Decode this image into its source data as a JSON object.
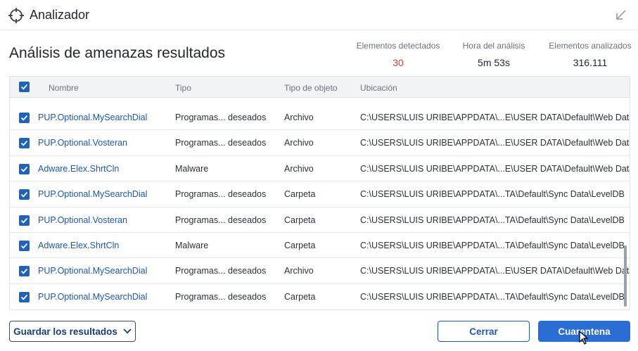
{
  "window": {
    "title": "Analizador"
  },
  "page": {
    "title": "Análisis de amenazas resultados"
  },
  "stats": {
    "detected_label": "Elementos detectados",
    "detected_value": "30",
    "time_label": "Hora del análisis",
    "time_value": "5m 53s",
    "scanned_label": "Elementos analizados",
    "scanned_value": "316.111"
  },
  "table": {
    "headers": {
      "name": "Nombre",
      "type": "Tipo",
      "object": "Tipo de objeto",
      "location": "Ubicación"
    },
    "rows": [
      {
        "name": "PUP.Optional.MySearchDial",
        "type": "Programas... deseados",
        "object": "Archivo",
        "location": "C:\\USERS\\LUIS URIBE\\APPDATA\\...E\\USER DATA\\Default\\Web Data",
        "checked": true
      },
      {
        "name": "PUP.Optional.Vosteran",
        "type": "Programas... deseados",
        "object": "Archivo",
        "location": "C:\\USERS\\LUIS URIBE\\APPDATA\\...E\\USER DATA\\Default\\Web Data",
        "checked": true
      },
      {
        "name": "Adware.Elex.ShrtCln",
        "type": "Malware",
        "object": "Archivo",
        "location": "C:\\USERS\\LUIS URIBE\\APPDATA\\...E\\USER DATA\\Default\\Web Data",
        "checked": true
      },
      {
        "name": "PUP.Optional.MySearchDial",
        "type": "Programas... deseados",
        "object": "Carpeta",
        "location": "C:\\USERS\\LUIS URIBE\\APPDATA\\...TA\\Default\\Sync Data\\LevelDB",
        "checked": true
      },
      {
        "name": "PUP.Optional.Vosteran",
        "type": "Programas... deseados",
        "object": "Carpeta",
        "location": "C:\\USERS\\LUIS URIBE\\APPDATA\\...TA\\Default\\Sync Data\\LevelDB",
        "checked": true
      },
      {
        "name": "Adware.Elex.ShrtCln",
        "type": "Malware",
        "object": "Carpeta",
        "location": "C:\\USERS\\LUIS URIBE\\APPDATA\\...TA\\Default\\Sync Data\\LevelDB",
        "checked": true
      },
      {
        "name": "PUP.Optional.MySearchDial",
        "type": "Programas... deseados",
        "object": "Archivo",
        "location": "C:\\USERS\\LUIS URIBE\\APPDATA\\...E\\USER DATA\\Default\\Web Data",
        "checked": true
      },
      {
        "name": "PUP.Optional.MySearchDial",
        "type": "Programas... deseados",
        "object": "Carpeta",
        "location": "C:\\USERS\\LUIS URIBE\\APPDATA\\...TA\\Default\\Sync Data\\LevelDB",
        "checked": true
      }
    ]
  },
  "buttons": {
    "save": "Guardar los resultados",
    "close": "Cerrar",
    "quarantine": "Cuarentena"
  },
  "colors": {
    "accent": "#2a6ed3",
    "link": "#1e58b0",
    "alert": "#c4473a",
    "checkbox": "#1e63b8"
  }
}
